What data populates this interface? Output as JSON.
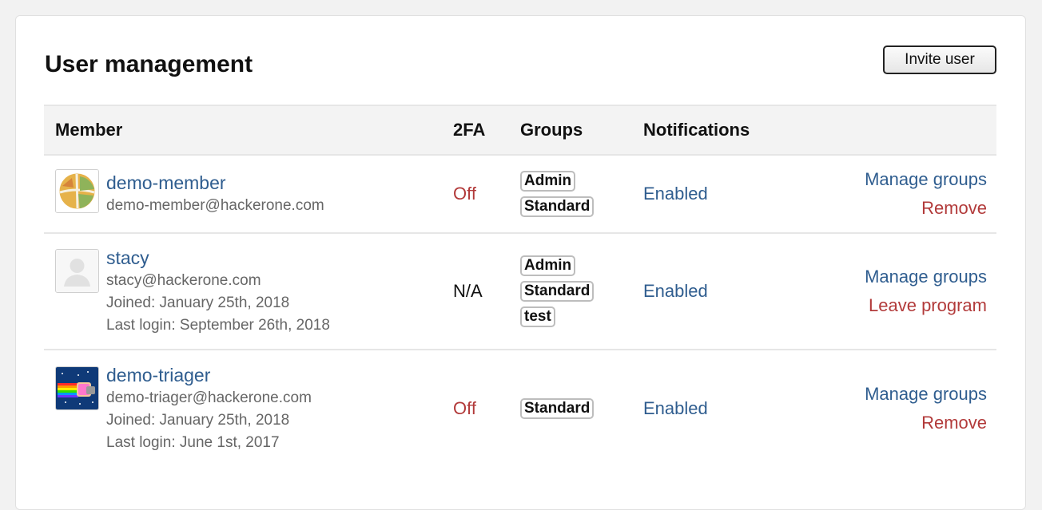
{
  "page": {
    "title": "User management",
    "invite_label": "Invite user"
  },
  "table": {
    "headers": {
      "member": "Member",
      "twofa": "2FA",
      "groups": "Groups",
      "notifications": "Notifications"
    },
    "rows": [
      {
        "name": "demo-member",
        "email": "demo-member@hackerone.com",
        "joined": "",
        "last_login": "",
        "twofa": "Off",
        "groups": [
          "Admin",
          "Standard"
        ],
        "notifications": "Enabled",
        "action_manage": "Manage groups",
        "action_remove": "Remove"
      },
      {
        "name": "stacy",
        "email": "stacy@hackerone.com",
        "joined": "Joined: January 25th, 2018",
        "last_login": "Last login: September 26th, 2018",
        "twofa": "N/A",
        "groups": [
          "Admin",
          "Standard",
          "test"
        ],
        "notifications": "Enabled",
        "action_manage": "Manage groups",
        "action_remove": "Leave program"
      },
      {
        "name": "demo-triager",
        "email": "demo-triager@hackerone.com",
        "joined": "Joined: January 25th, 2018",
        "last_login": "Last login: June 1st, 2017",
        "twofa": "Off",
        "groups": [
          "Standard"
        ],
        "notifications": "Enabled",
        "action_manage": "Manage groups",
        "action_remove": "Remove"
      }
    ]
  },
  "colors": {
    "link": "#2f5d8f",
    "danger": "#b23a3a"
  }
}
